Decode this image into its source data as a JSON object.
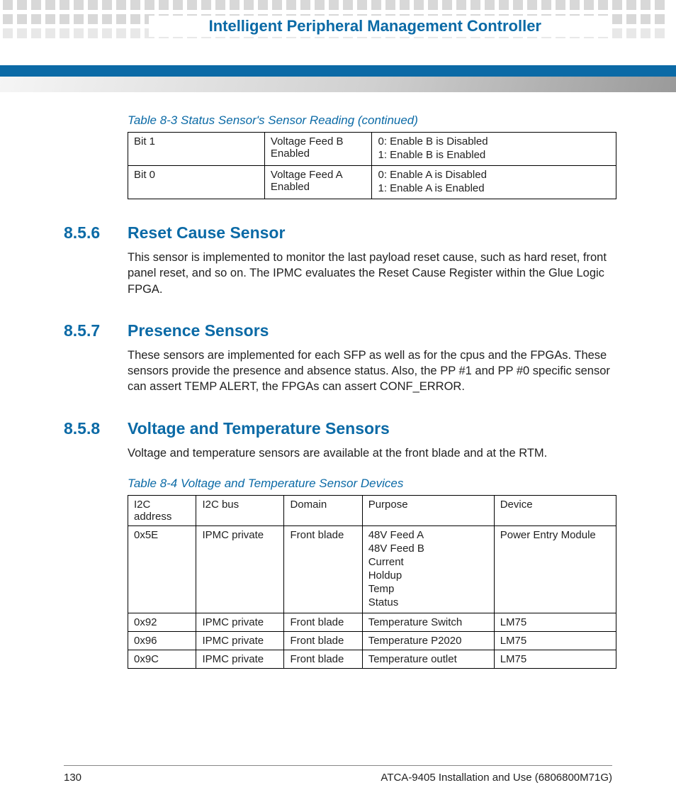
{
  "header": {
    "title": "Intelligent Peripheral Management Controller"
  },
  "table83": {
    "caption": "Table 8-3 Status Sensor's Sensor Reading (continued)",
    "rows": [
      {
        "c0": "Bit 1",
        "c1": "Voltage Feed B Enabled",
        "c2a": "0: Enable B is Disabled",
        "c2b": "1: Enable B is Enabled"
      },
      {
        "c0": "Bit 0",
        "c1": "Voltage Feed A Enabled",
        "c2a": "0: Enable A is Disabled",
        "c2b": "1: Enable A is Enabled"
      }
    ]
  },
  "sections": {
    "s856": {
      "num": "8.5.6",
      "title": "Reset Cause Sensor",
      "body": "This sensor is implemented to monitor the last payload reset cause, such as hard reset, front panel reset, and so on. The IPMC evaluates the Reset Cause Register within the Glue Logic FPGA."
    },
    "s857": {
      "num": "8.5.7",
      "title": "Presence Sensors",
      "body": "These sensors are implemented for each SFP as well as for the cpus and the FPGAs. These sensors provide the presence and absence status. Also, the PP #1 and PP #0 specific sensor can assert TEMP ALERT, the FPGAs can assert CONF_ERROR."
    },
    "s858": {
      "num": "8.5.8",
      "title": "Voltage and Temperature Sensors",
      "body": "Voltage and temperature sensors are available at the front blade and at the RTM."
    }
  },
  "table84": {
    "caption": "Table 8-4 Voltage and Temperature Sensor Devices",
    "headers": {
      "h0": "I2C address",
      "h1": "I2C bus",
      "h2": "Domain",
      "h3": "Purpose",
      "h4": "Device"
    },
    "rows": [
      {
        "c0": "0x5E",
        "c1": "IPMC private",
        "c2": "Front blade",
        "c3": [
          "48V Feed A",
          "48V Feed B",
          "Current",
          "Holdup",
          "Temp",
          "Status"
        ],
        "c4": "Power Entry Module"
      },
      {
        "c0": "0x92",
        "c1": "IPMC private",
        "c2": "Front blade",
        "c3": [
          "Temperature Switch"
        ],
        "c4": "LM75"
      },
      {
        "c0": "0x96",
        "c1": "IPMC private",
        "c2": "Front blade",
        "c3": [
          "Temperature P2020"
        ],
        "c4": "LM75"
      },
      {
        "c0": "0x9C",
        "c1": "IPMC private",
        "c2": "Front blade",
        "c3": [
          "Temperature outlet"
        ],
        "c4": "LM75"
      }
    ]
  },
  "footer": {
    "page": "130",
    "doc": "ATCA-9405 Installation and Use (6806800M71G)"
  }
}
